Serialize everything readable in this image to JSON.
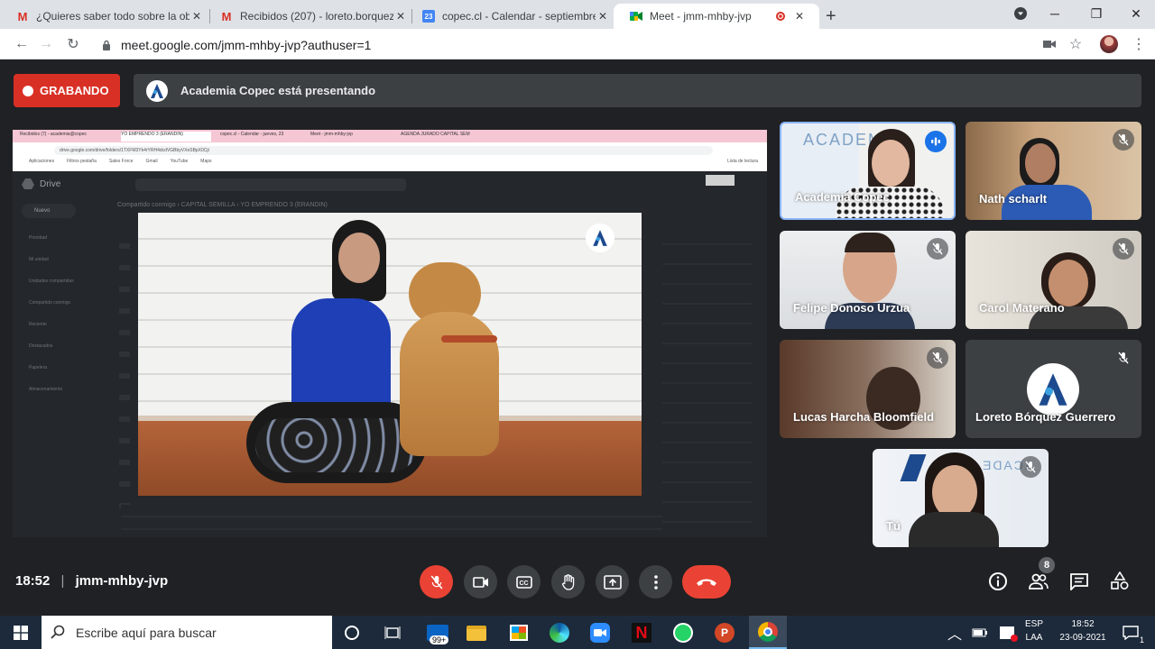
{
  "browser": {
    "tabs": [
      {
        "title": "¿Quieres saber todo sobre la obe",
        "icon": "gmail-icon"
      },
      {
        "title": "Recibidos (207) - loreto.borquez@",
        "icon": "gmail-icon"
      },
      {
        "title": "copec.cl - Calendar - septiembre",
        "icon": "calendar-icon",
        "badge": "23"
      },
      {
        "title": "Meet - jmm-mhby-jvp",
        "icon": "meet-icon",
        "active": true
      }
    ],
    "url": "meet.google.com/jmm-mhby-jvp?authuser=1"
  },
  "meet": {
    "recording_label": "GRABANDO",
    "presenting_text": "Academia Copec está presentando",
    "meeting_time": "18:52",
    "meeting_code": "jmm-mhby-jvp",
    "participants_count": "8",
    "participants": [
      {
        "name": "Academia Copec",
        "speaking": true
      },
      {
        "name": "Nath scharlt",
        "muted": true
      },
      {
        "name": "Felipe Donoso Urzua",
        "muted": true
      },
      {
        "name": "Carol Materano",
        "muted": true
      },
      {
        "name": "Lucas Harcha Bloomfield",
        "muted": true
      },
      {
        "name": "Loreto Bórquez Guerrero",
        "muted": true
      },
      {
        "name": "Tú",
        "muted": true
      }
    ]
  },
  "shared_screen": {
    "tabs": [
      "Recibidos (7) - academia@copec",
      "YO EMPRENDO 3 (ERANDIN)",
      "copec.cl - Calendar - jueves, 23",
      "Meet - jmm-mhby-jvp",
      "AGENDA JURADO CAPITAL SEM"
    ],
    "url": "drive.google.com/drive/folders/1TXFM3Yk4rYRH4dcdVGBbyVXeSBpX0Cjt",
    "bookmarks": [
      "Aplicaciones",
      "Filtros pestaña",
      "Sales Force",
      "Gmail",
      "YouTube",
      "Maps"
    ],
    "reading_list": "Lista de lectura",
    "drive_label": "Drive",
    "new_label": "Nuevo",
    "breadcrumb": "Compartido conmigo › CAPITAL SEMILLA › YO EMPRENDO 3 (ERANDIN)",
    "sidebar": [
      "Prioridad",
      "Mi unidad",
      "Unidades compartidas",
      "Compartido conmigo",
      "Reciente",
      "Destacados",
      "Papelera",
      "Almacenamiento"
    ]
  },
  "taskbar": {
    "search_placeholder": "Escribe aquí para buscar",
    "mail_badge": "99+",
    "lang_top": "ESP",
    "lang_bottom": "LAA",
    "time": "18:52",
    "date": "23-09-2021",
    "notif_count": "1"
  },
  "colors": {
    "meet_bg": "#202124",
    "recording_red": "#d93025",
    "speaking_blue": "#1a73e8",
    "end_call_red": "#ea4335"
  }
}
